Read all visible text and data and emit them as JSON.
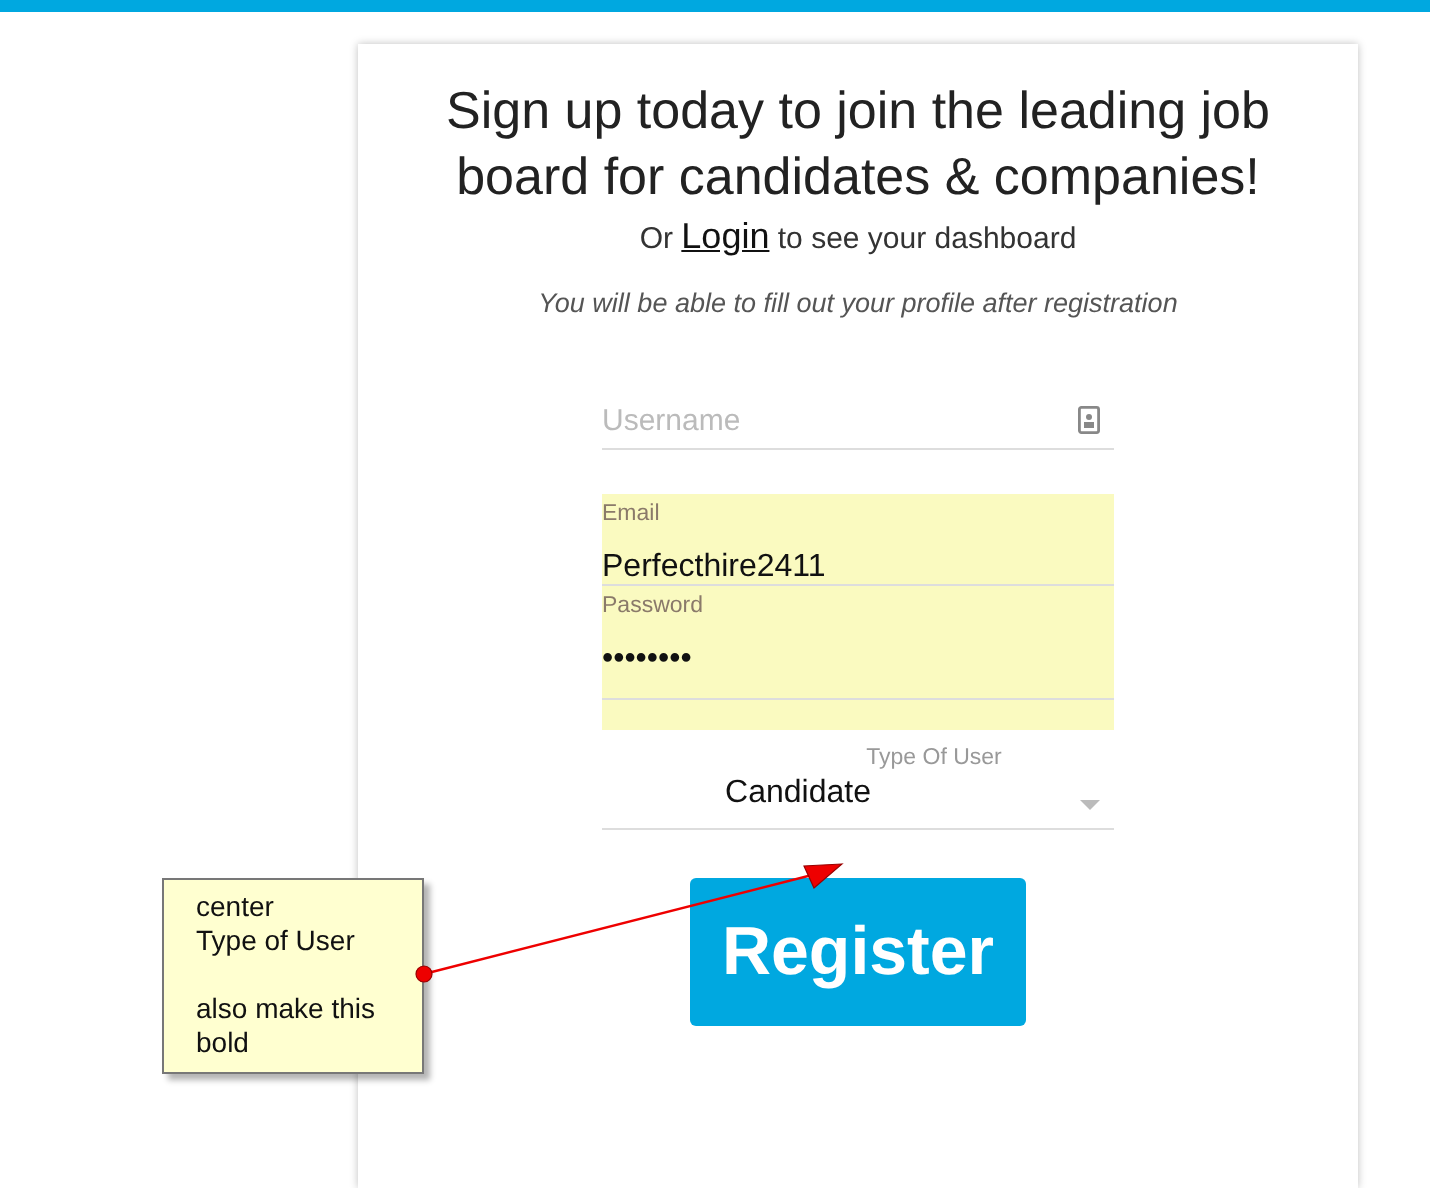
{
  "page": {
    "heading": "Sign up today to join the leading job board for candidates & companies!",
    "login_prefix": "Or",
    "login_link": "Login",
    "login_suffix": "to see your dashboard",
    "note": "You will be able to fill out your profile after registration"
  },
  "fields": [
    {
      "kind": "text",
      "placeholder": "Username",
      "autofilled": false
    },
    {
      "kind": "text",
      "label": "Email",
      "value": "Perfecthire2411",
      "autofilled": true
    },
    {
      "kind": "password",
      "label": "Password",
      "value": "••••••••",
      "autofilled": true
    },
    {
      "kind": "select",
      "label": "Type Of User",
      "value": "Candidate"
    }
  ],
  "register_button": "Register",
  "annotation": {
    "text": "center\nType of User\n\nalso make this\nbold"
  }
}
